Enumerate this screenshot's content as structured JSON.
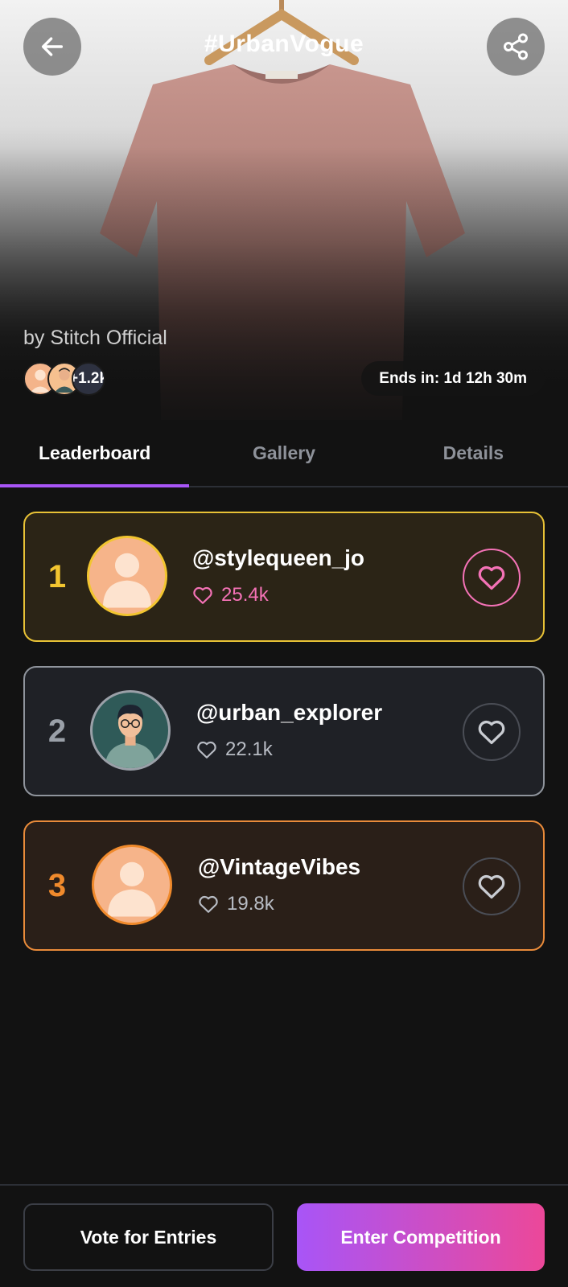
{
  "hero": {
    "title": "#UrbanVogue",
    "byline": "by Stitch Official",
    "participants_count": "+1.2k",
    "ends_in": "Ends in: 1d 12h 30m",
    "icons": {
      "back": "arrow-left-icon",
      "share": "share-icon"
    }
  },
  "tabs": [
    {
      "label": "Leaderboard",
      "active": true
    },
    {
      "label": "Gallery",
      "active": false
    },
    {
      "label": "Details",
      "active": false
    }
  ],
  "leaderboard": [
    {
      "rank": "1",
      "username": "@stylequeen_jo",
      "likes": "25.4k",
      "tier": "gold"
    },
    {
      "rank": "2",
      "username": "@urban_explorer",
      "likes": "22.1k",
      "tier": "silver"
    },
    {
      "rank": "3",
      "username": "@VintageVibes",
      "likes": "19.8k",
      "tier": "bronze"
    }
  ],
  "actions": {
    "vote_label": "Vote for Entries",
    "enter_label": "Enter Competition"
  },
  "colors": {
    "gold": "#f2c530",
    "silver": "#9aa0a8",
    "bronze": "#f08a2c",
    "accent_purple": "#a855f7",
    "accent_pink": "#ec4899",
    "like_pink": "#f472b6"
  }
}
